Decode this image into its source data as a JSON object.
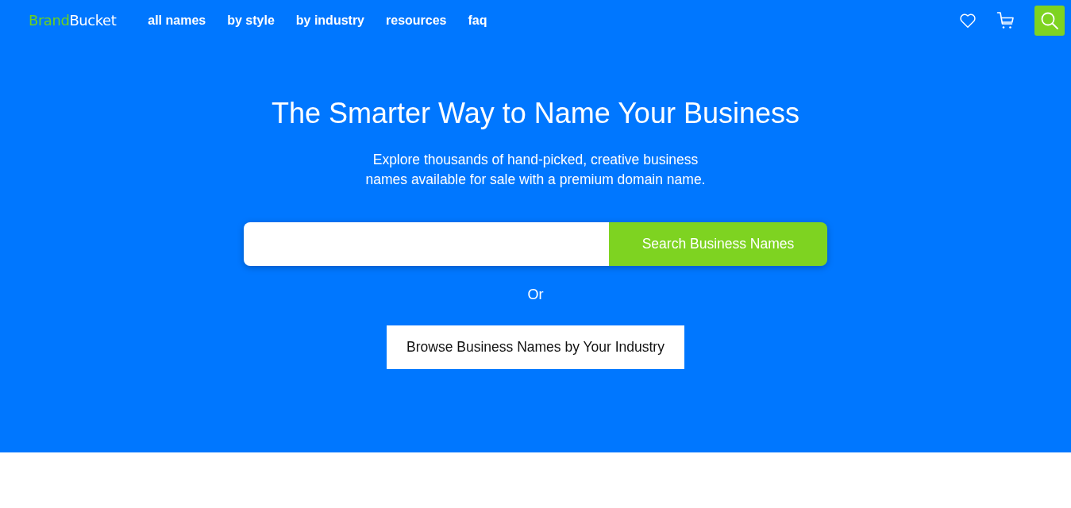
{
  "header": {
    "logo": [
      "Brand",
      "Bucket"
    ],
    "nav": [
      "all names",
      "by style",
      "by industry",
      "resources",
      "faq"
    ]
  },
  "hero": {
    "title": "The Smarter Way to Name Your Business",
    "subtitle": "Explore thousands of hand-picked, creative business names available for sale with a premium domain name.",
    "search_button": "Search Business Names",
    "separator": "Or",
    "browse_button": "Browse Business Names by Your Industry"
  }
}
